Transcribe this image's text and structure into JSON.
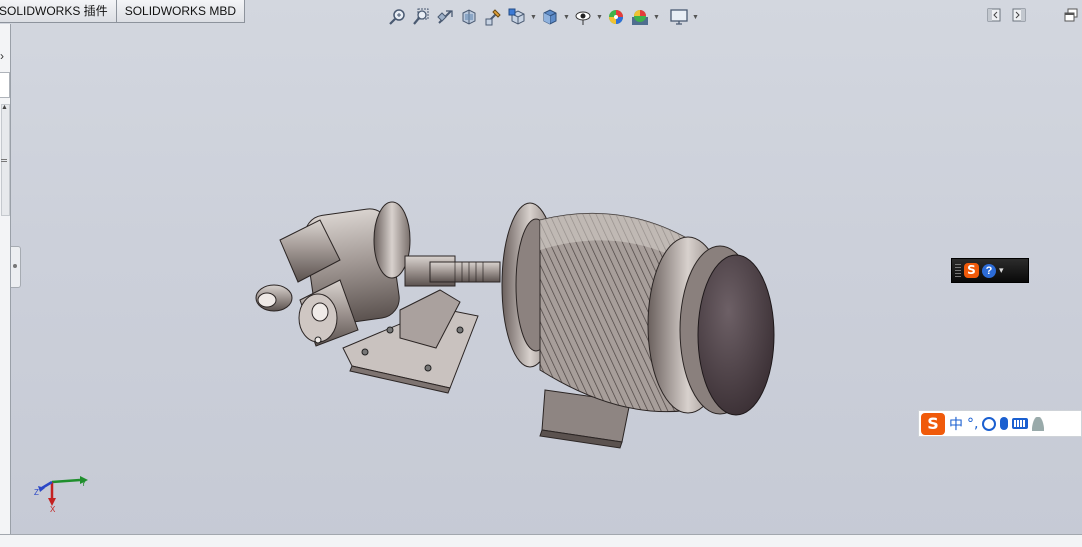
{
  "tabs": [
    "SOLIDWORKS 插件",
    "SOLIDWORKS MBD"
  ],
  "hud_tools": [
    {
      "name": "zoom-to-fit-icon",
      "drop": false
    },
    {
      "name": "zoom-to-area-icon",
      "drop": false
    },
    {
      "name": "previous-view-icon",
      "drop": false
    },
    {
      "name": "section-view-icon",
      "drop": false
    },
    {
      "name": "dynamic-annotation-icon",
      "drop": false
    },
    {
      "name": "view-orientation-icon",
      "drop": true
    },
    {
      "name": "display-style-icon",
      "drop": true
    },
    {
      "name": "hide-show-items-icon",
      "drop": true
    },
    {
      "name": "edit-appearance-icon",
      "drop": false
    },
    {
      "name": "apply-scene-icon",
      "drop": true
    },
    {
      "name": "view-settings-icon",
      "drop": true
    }
  ],
  "window_controls": [
    "restore-left-icon",
    "restore-right-icon",
    "maximize-icon"
  ],
  "ime": {
    "toolbar_items": [
      "中",
      "°,"
    ],
    "logo_letter": "S",
    "help_symbol": "?"
  },
  "triad": {
    "x_label": "X",
    "y_label": "Y",
    "z_label": "Z"
  },
  "colors": {
    "viewport_top": "#d3d7df",
    "viewport_bottom": "#c6cad5",
    "ime_orange": "#f05a0a",
    "ime_blue": "#1a5fd0"
  }
}
